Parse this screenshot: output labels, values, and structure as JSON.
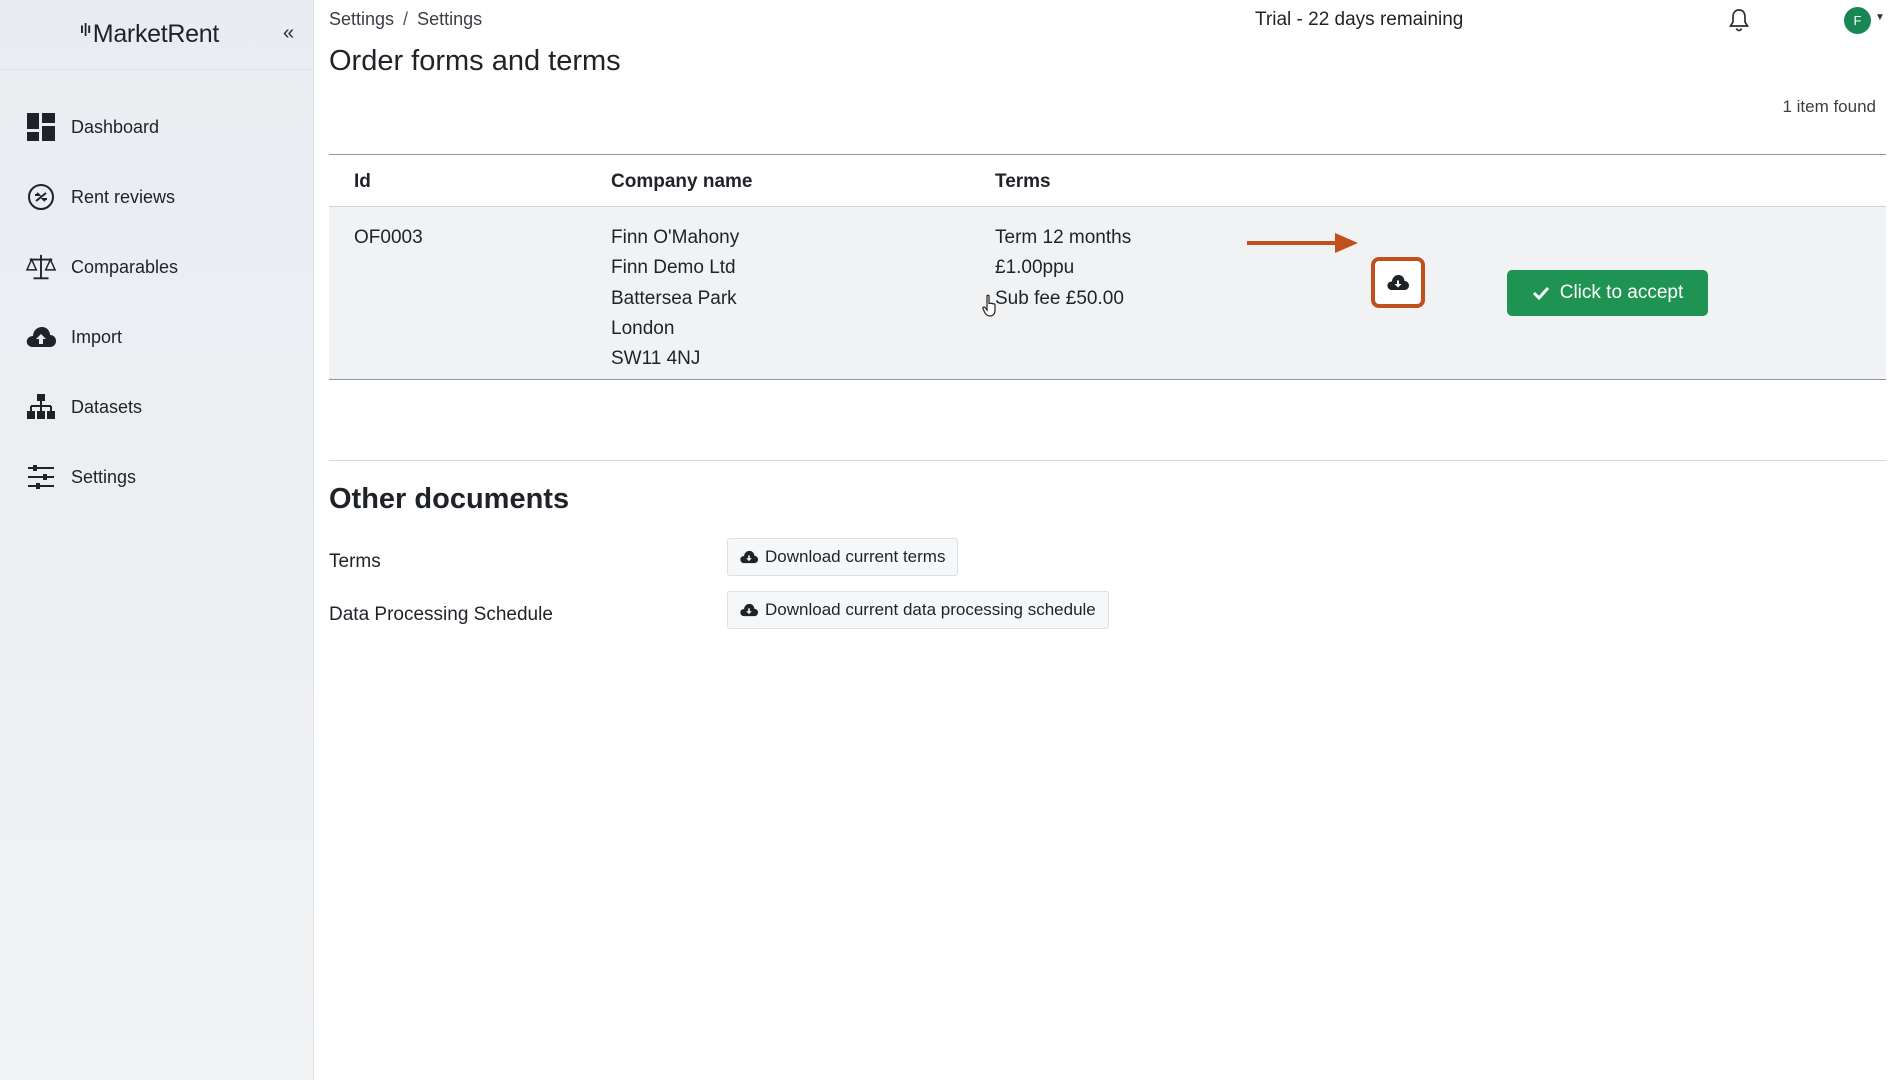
{
  "app": {
    "brand": "MarketRent"
  },
  "sidebar": {
    "collapse_glyph": "«",
    "items": [
      {
        "label": "Dashboard",
        "icon": "dashboard-icon"
      },
      {
        "label": "Rent reviews",
        "icon": "rent-reviews-icon"
      },
      {
        "label": "Comparables",
        "icon": "scales-icon"
      },
      {
        "label": "Import",
        "icon": "cloud-upload-icon"
      },
      {
        "label": "Datasets",
        "icon": "sitemap-icon"
      },
      {
        "label": "Settings",
        "icon": "sliders-icon"
      }
    ]
  },
  "header": {
    "breadcrumb": [
      "Settings",
      "Settings"
    ],
    "breadcrumb_separator": "/",
    "trial_text": "Trial - 22 days remaining",
    "avatar_initial": "F"
  },
  "page": {
    "title": "Order forms and terms",
    "item_count": "1 item found"
  },
  "table": {
    "headers": {
      "id": "Id",
      "company": "Company name",
      "terms": "Terms"
    },
    "rows": [
      {
        "id": "OF0003",
        "company_lines": [
          "Finn O'Mahony",
          "Finn Demo Ltd",
          "Battersea Park",
          "London",
          "SW11 4NJ"
        ],
        "terms_lines": [
          "Term 12 months",
          "£1.00ppu",
          "Sub fee £50.00"
        ],
        "accept_label": "Click to accept"
      }
    ]
  },
  "other_documents": {
    "title": "Other documents",
    "docs": [
      {
        "label": "Terms",
        "button": "Download current terms"
      },
      {
        "label": "Data Processing Schedule",
        "button": "Download current data processing schedule"
      }
    ]
  },
  "colors": {
    "accent_green": "#1f9352",
    "highlight_orange": "#c0511c",
    "avatar_green": "#198754"
  }
}
